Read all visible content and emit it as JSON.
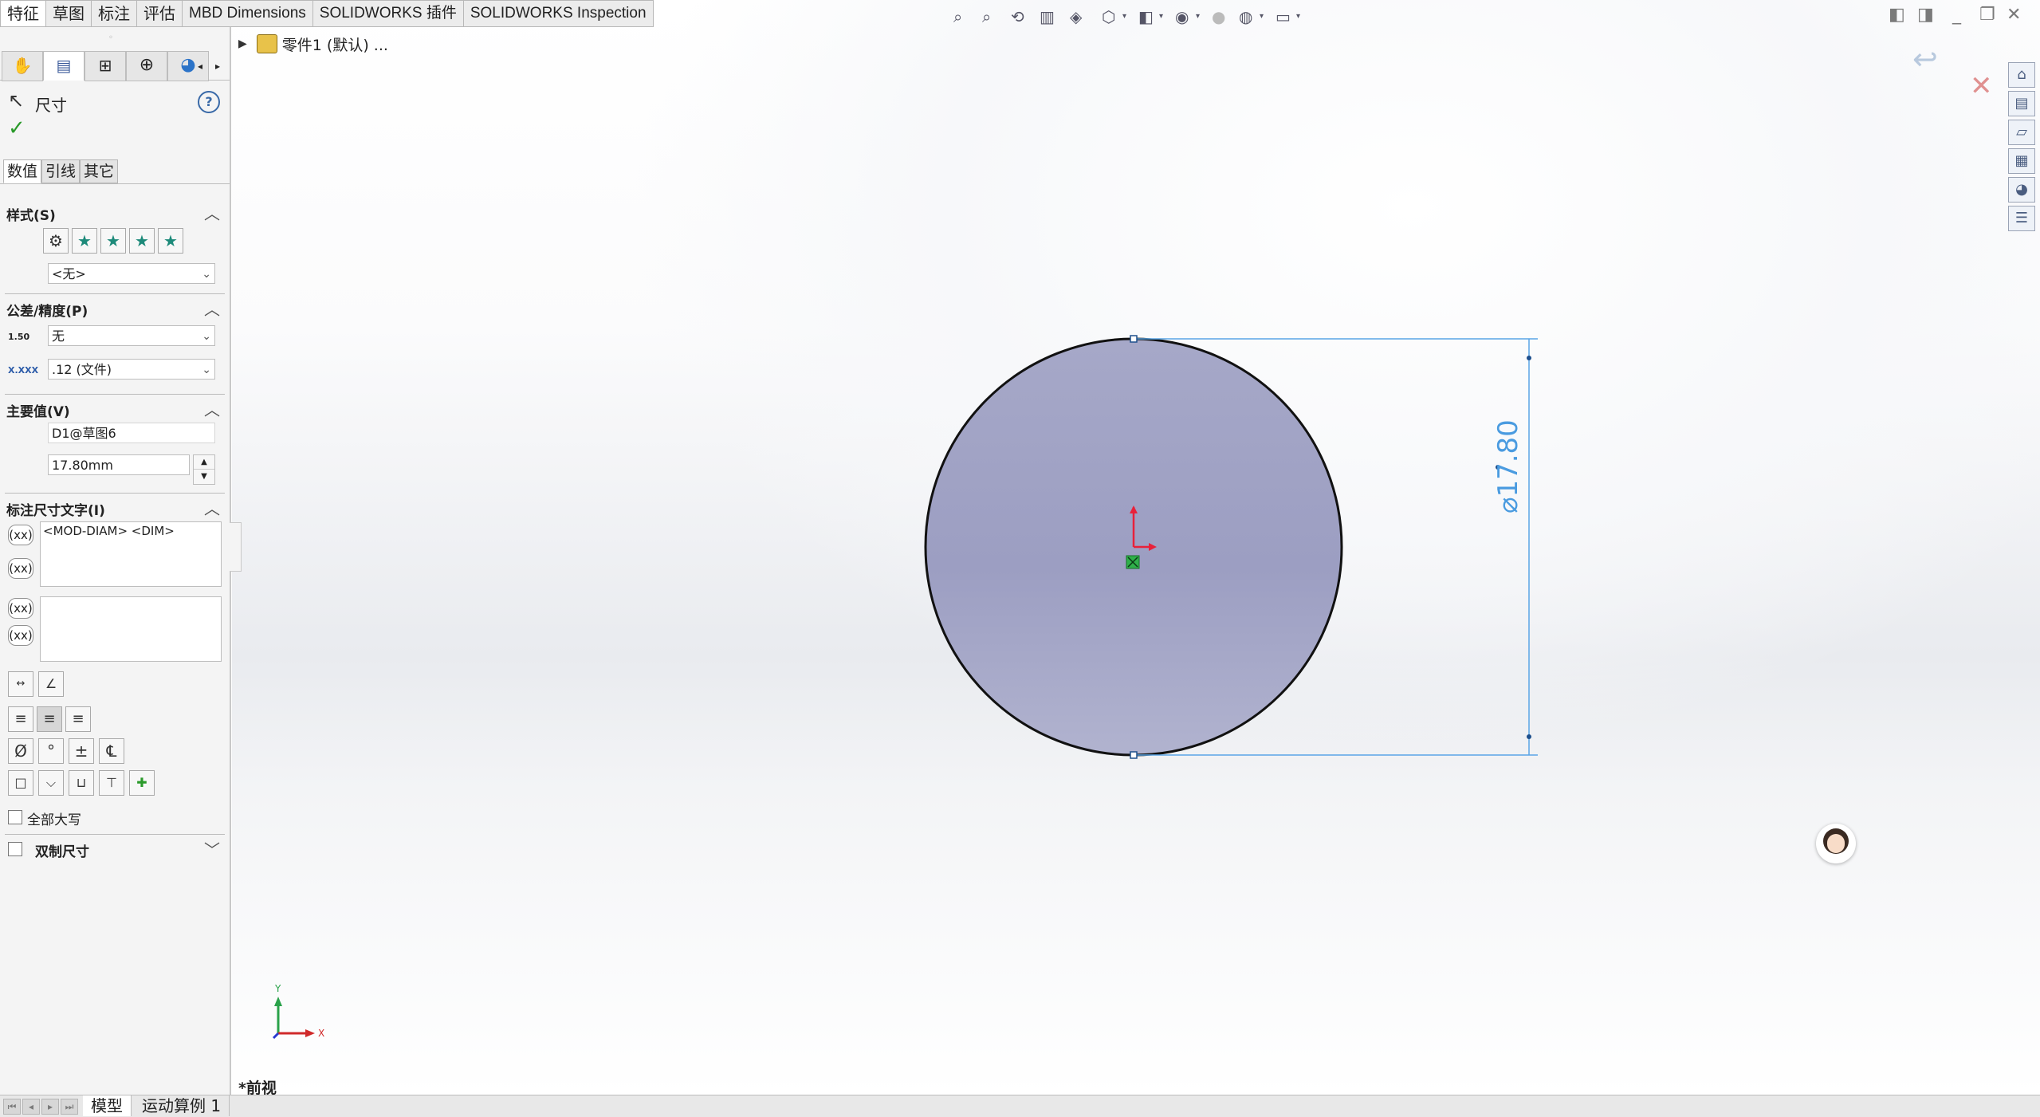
{
  "ribbon": {
    "tabs": [
      {
        "label": "特征"
      },
      {
        "label": "草图"
      },
      {
        "label": "标注"
      },
      {
        "label": "评估"
      },
      {
        "label": "MBD Dimensions"
      },
      {
        "label": "SOLIDWORKS 插件"
      },
      {
        "label": "SOLIDWORKS Inspection"
      }
    ]
  },
  "tree": {
    "part_label": "零件1 (默认) ..."
  },
  "panel": {
    "title": "尺寸",
    "tabs": [
      "数值",
      "引线",
      "其它"
    ],
    "style": {
      "header": "样式(S)",
      "preset": "<无>"
    },
    "tolerance": {
      "header": "公差/精度(P)",
      "tolerance_type": "无",
      "precision": ".12 (文件)",
      "icon1_text": "1.50",
      "icon2_text": "X.XXX"
    },
    "primary": {
      "header": "主要值(V)",
      "name": "D1@草图6",
      "value": "17.80mm"
    },
    "dim_text": {
      "header": "标注尺寸文字(I)",
      "text1": "<MOD-DIAM> <DIM>",
      "text2": "",
      "xx_label": "(xx)"
    },
    "symbols": {
      "diameter": "Ø",
      "degree": "°",
      "plusminus": "±",
      "centerline": "℄"
    },
    "all_caps": "全部大写",
    "dual": "双制尺寸"
  },
  "graphics": {
    "dimension_text": "⌀17.80",
    "view_label": "*前视",
    "triad_y": "Y",
    "triad_x": "X"
  },
  "bottom": {
    "tabs": [
      "模型",
      "运动算例 1"
    ]
  },
  "colors": {
    "accent": "#2e86de",
    "circle_fill": "#a3a5c6",
    "dim_blue": "#4a9be0",
    "check": "#2a9a2a"
  }
}
